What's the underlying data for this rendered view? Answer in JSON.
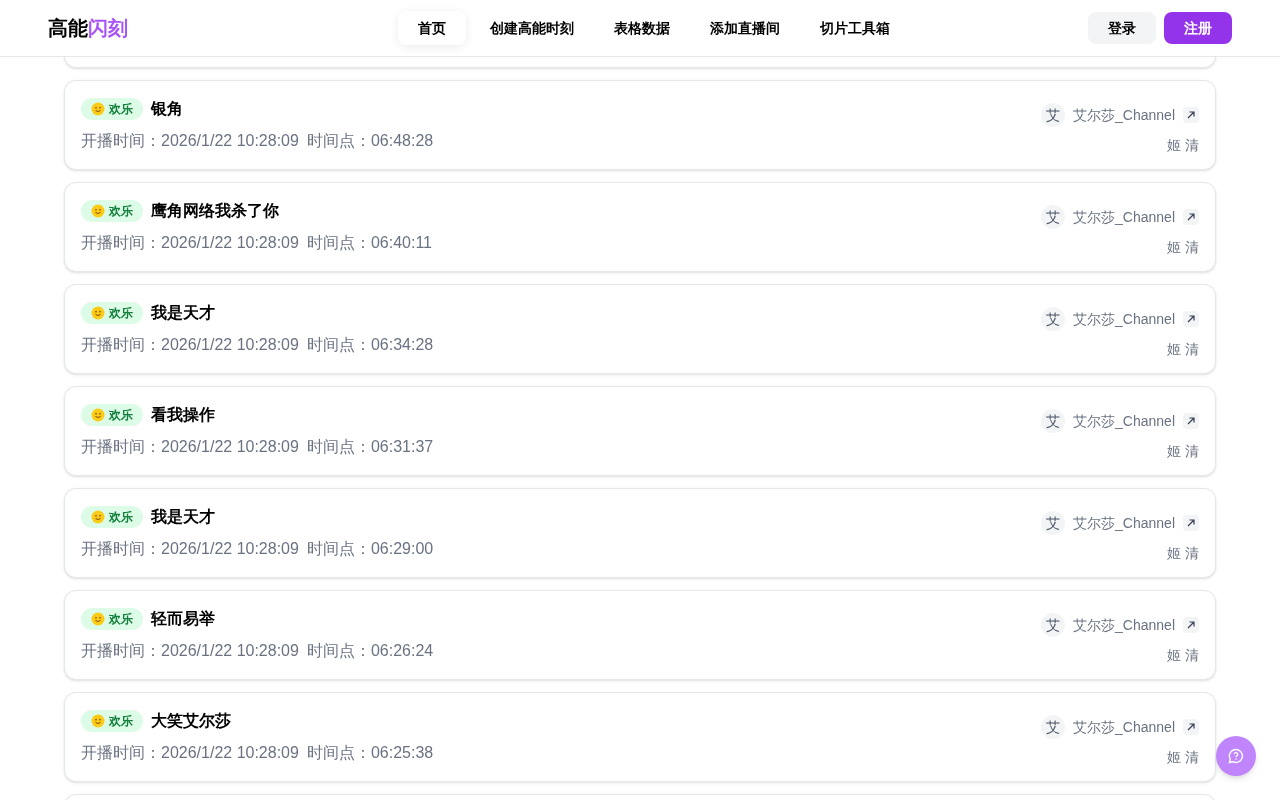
{
  "header": {
    "logo_main": "高能",
    "logo_accent": "闪刻",
    "nav": [
      {
        "label": "首页",
        "selected": true
      },
      {
        "label": "创建高能时刻",
        "selected": false
      },
      {
        "label": "表格数据",
        "selected": false
      },
      {
        "label": "添加直播间",
        "selected": false
      },
      {
        "label": "切片工具箱",
        "selected": false
      }
    ],
    "login": "登录",
    "register": "注册"
  },
  "cards": [
    {
      "tag": "欢乐",
      "title": "银角",
      "start_label": "开播时间：",
      "start_time": "2026/1/22 10:28:09",
      "point_label": "时间点：",
      "point": "06:48:28",
      "avatar": "艾",
      "channel": "艾尔莎_Channel",
      "author": "姬 清"
    },
    {
      "tag": "欢乐",
      "title": "鹰角网络我杀了你",
      "start_label": "开播时间：",
      "start_time": "2026/1/22 10:28:09",
      "point_label": "时间点：",
      "point": "06:40:11",
      "avatar": "艾",
      "channel": "艾尔莎_Channel",
      "author": "姬 清"
    },
    {
      "tag": "欢乐",
      "title": "我是天才",
      "start_label": "开播时间：",
      "start_time": "2026/1/22 10:28:09",
      "point_label": "时间点：",
      "point": "06:34:28",
      "avatar": "艾",
      "channel": "艾尔莎_Channel",
      "author": "姬 清"
    },
    {
      "tag": "欢乐",
      "title": "看我操作",
      "start_label": "开播时间：",
      "start_time": "2026/1/22 10:28:09",
      "point_label": "时间点：",
      "point": "06:31:37",
      "avatar": "艾",
      "channel": "艾尔莎_Channel",
      "author": "姬 清"
    },
    {
      "tag": "欢乐",
      "title": "我是天才",
      "start_label": "开播时间：",
      "start_time": "2026/1/22 10:28:09",
      "point_label": "时间点：",
      "point": "06:29:00",
      "avatar": "艾",
      "channel": "艾尔莎_Channel",
      "author": "姬 清"
    },
    {
      "tag": "欢乐",
      "title": "轻而易举",
      "start_label": "开播时间：",
      "start_time": "2026/1/22 10:28:09",
      "point_label": "时间点：",
      "point": "06:26:24",
      "avatar": "艾",
      "channel": "艾尔莎_Channel",
      "author": "姬 清"
    },
    {
      "tag": "欢乐",
      "title": "大笑艾尔莎",
      "start_label": "开播时间：",
      "start_time": "2026/1/22 10:28:09",
      "point_label": "时间点：",
      "point": "06:25:38",
      "avatar": "艾",
      "channel": "艾尔莎_Channel",
      "author": "姬 清"
    }
  ]
}
